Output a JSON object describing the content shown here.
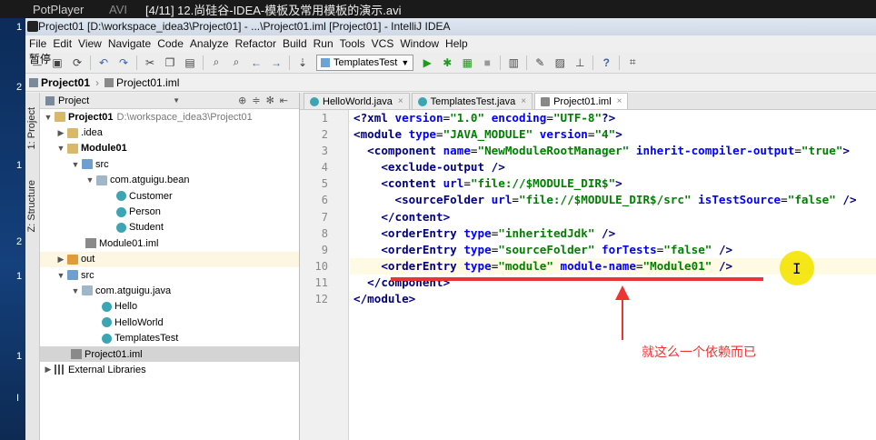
{
  "desktop": {
    "edge_digits": [
      "1",
      "2",
      "1",
      "2",
      "1",
      "1",
      "I"
    ]
  },
  "player": {
    "app": "PotPlayer",
    "format": "AVI",
    "title": "[4/11] 12.尚硅谷-IDEA-模板及常用模板的演示.avi"
  },
  "window": {
    "title": "Project01 [D:\\workspace_idea3\\Project01] - ...\\Project01.iml [Project01] - IntelliJ IDEA"
  },
  "menu": {
    "overlay": "暂停",
    "items": [
      "File",
      "Edit",
      "View",
      "Navigate",
      "Code",
      "Analyze",
      "Refactor",
      "Build",
      "Run",
      "Tools",
      "VCS",
      "Window",
      "Help"
    ]
  },
  "toolbar": {
    "run_config": "TemplatesTest"
  },
  "navbar": {
    "crumbs": [
      "Project01",
      "Project01.iml"
    ]
  },
  "side_stripe": {
    "project": "1: Project",
    "structure": "Z: Structure"
  },
  "project_panel": {
    "selector": "Project",
    "tree": [
      {
        "label": "Project01",
        "path": "D:\\workspace_idea3\\Project01"
      },
      {
        "label": ".idea"
      },
      {
        "label": "Module01"
      },
      {
        "label": "src"
      },
      {
        "label": "com.atguigu.bean"
      },
      {
        "label": "Customer"
      },
      {
        "label": "Person"
      },
      {
        "label": "Student"
      },
      {
        "label": "Module01.iml"
      },
      {
        "label": "out"
      },
      {
        "label": "src"
      },
      {
        "label": "com.atguigu.java"
      },
      {
        "label": "Hello"
      },
      {
        "label": "HelloWorld"
      },
      {
        "label": "TemplatesTest"
      },
      {
        "label": "Project01.iml"
      },
      {
        "label": "External Libraries"
      }
    ]
  },
  "editor": {
    "tabs": [
      "HelloWorld.java",
      "TemplatesTest.java",
      "Project01.iml"
    ],
    "line_numbers": [
      "1",
      "2",
      "3",
      "4",
      "5",
      "6",
      "7",
      "8",
      "9",
      "10",
      "11",
      "12"
    ]
  },
  "annotation": {
    "note": "就这么一个依赖而已"
  }
}
